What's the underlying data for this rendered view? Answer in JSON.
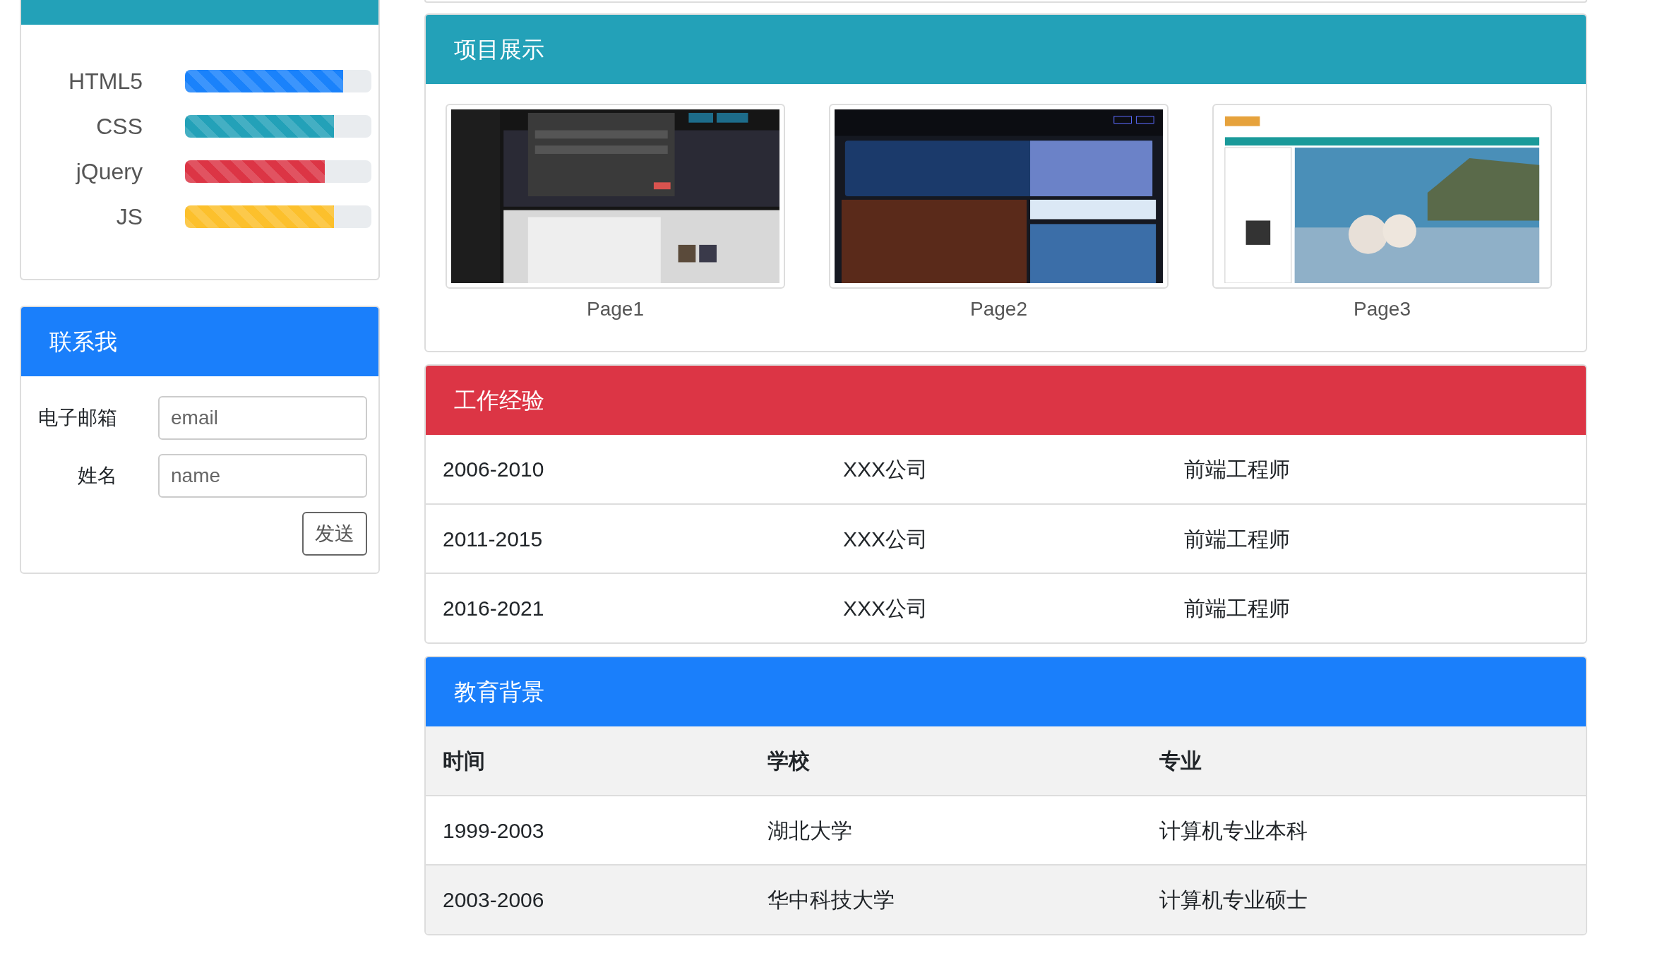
{
  "skills_card": {
    "skills": [
      {
        "label": "HTML5",
        "level": 0.85,
        "color": "#1a82fb"
      },
      {
        "label": "CSS",
        "level": 0.8,
        "color": "#23a1b8"
      },
      {
        "label": "jQuery",
        "level": 0.75,
        "color": "#dc3545"
      },
      {
        "label": "JS",
        "level": 0.8,
        "color": "#fcc02c"
      }
    ]
  },
  "contact_card": {
    "title": "联系我",
    "fields": [
      {
        "label": "电子邮箱",
        "placeholder": "email"
      },
      {
        "label": "姓名",
        "placeholder": "name"
      }
    ],
    "button": "发送"
  },
  "projects_card": {
    "title": "项目展示",
    "projects": [
      {
        "caption": "Page1",
        "kind": "dark"
      },
      {
        "caption": "Page2",
        "kind": "game"
      },
      {
        "caption": "Page3",
        "kind": "travel"
      }
    ]
  },
  "experience_card": {
    "title": "工作经验",
    "rows": [
      [
        "2006-2010",
        "XXX公司",
        "前端工程师"
      ],
      [
        "2011-2015",
        "XXX公司",
        "前端工程师"
      ],
      [
        "2016-2021",
        "XXX公司",
        "前端工程师"
      ]
    ]
  },
  "education_card": {
    "title": "教育背景",
    "columns": [
      "时间",
      "学校",
      "专业"
    ],
    "rows": [
      [
        "1999-2003",
        "湖北大学",
        "计算机专业本科"
      ],
      [
        "2003-2006",
        "华中科技大学",
        "计算机专业硕士"
      ]
    ]
  }
}
